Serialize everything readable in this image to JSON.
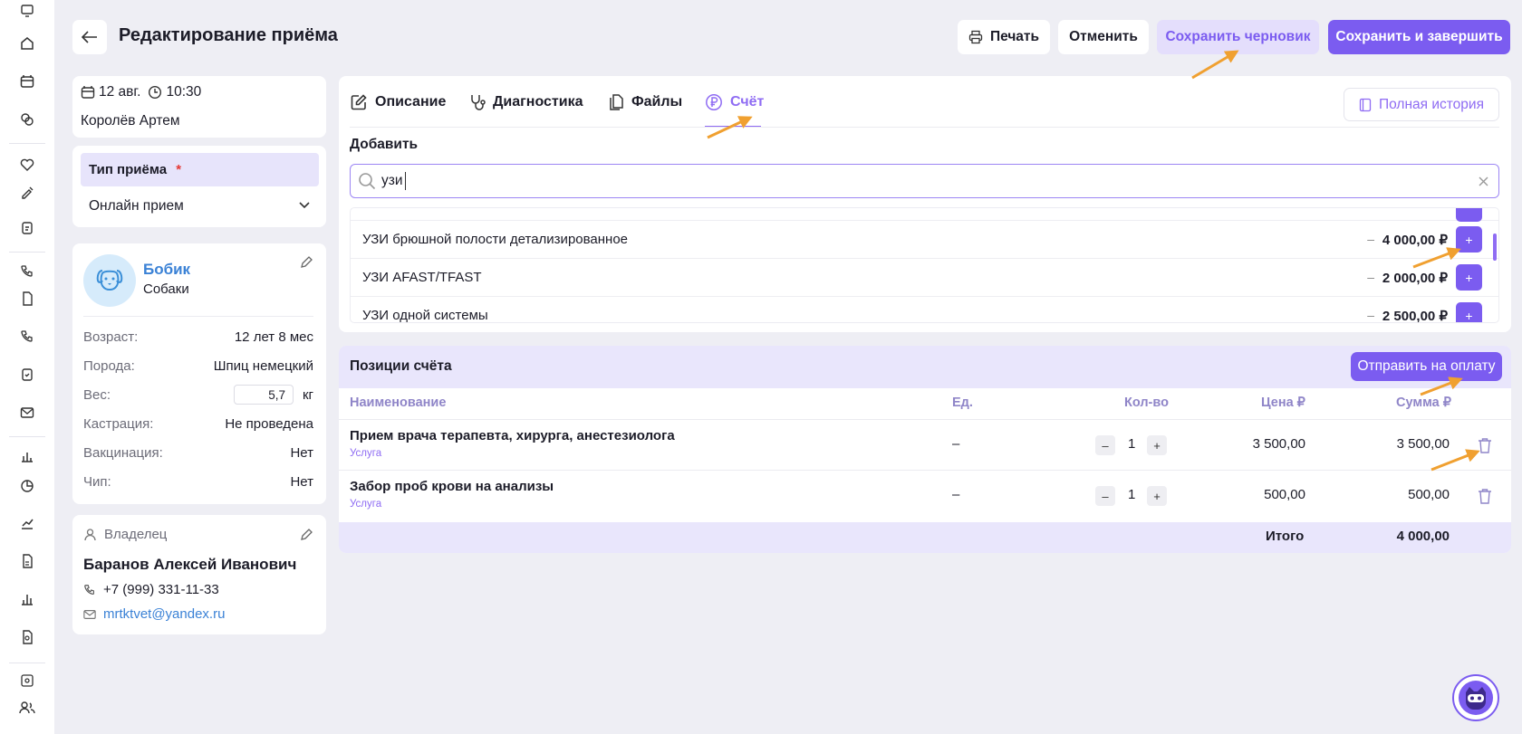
{
  "header": {
    "title": "Редактирование приёма",
    "print_label": "Печать",
    "cancel_label": "Отменить",
    "save_draft_label": "Сохранить черновик",
    "save_finish_label": "Сохранить и завершить"
  },
  "visit": {
    "date": "12 авг.",
    "time": "10:30",
    "doctor": "Королёв Артем"
  },
  "visit_type": {
    "label": "Тип приёма",
    "required_mark": "*",
    "value": "Онлайн прием"
  },
  "pet": {
    "name": "Бобик",
    "species": "Собаки",
    "rows": [
      {
        "label": "Возраст:",
        "value": "12 лет 8 мес"
      },
      {
        "label": "Порода:",
        "value": "Шпиц немецкий"
      },
      {
        "label": "Вес:",
        "value": "5,7",
        "unit": "кг"
      },
      {
        "label": "Кастрация:",
        "value": "Не проведена"
      },
      {
        "label": "Вакцинация:",
        "value": "Нет"
      },
      {
        "label": "Чип:",
        "value": "Нет"
      }
    ]
  },
  "owner": {
    "section_label": "Владелец",
    "name": "Баранов Алексей Иванович",
    "phone": "+7 (999) 331-11-33",
    "email": "mrtktvet@yandex.ru"
  },
  "tabs": [
    {
      "label": "Описание",
      "icon": "edit-icon"
    },
    {
      "label": "Диагностика",
      "icon": "stethoscope-icon"
    },
    {
      "label": "Файлы",
      "icon": "files-icon"
    },
    {
      "label": "Счёт",
      "icon": "ruble-icon",
      "active": true
    }
  ],
  "history_label": "Полная история",
  "add": {
    "label": "Добавить",
    "search_value": "узи",
    "results": [
      {
        "name": "УЗИ брюшной полости детализированное",
        "dash": "–",
        "price": "4 000,00 ₽",
        "add": "+"
      },
      {
        "name": "УЗИ AFAST/TFAST",
        "dash": "–",
        "price": "2 000,00 ₽",
        "add": "+"
      },
      {
        "name": "УЗИ одной системы",
        "dash": "–",
        "price": "2 500,00 ₽",
        "add": "+"
      }
    ]
  },
  "invoice": {
    "title": "Позиции счёта",
    "send_label": "Отправить на оплату",
    "columns": [
      "Наименование",
      "Ед.",
      "Кол-во",
      "Цена ₽",
      "Сумма ₽"
    ],
    "rows": [
      {
        "name": "Прием врача терапевта, хирурга, анестезиолога",
        "type": "Услуга",
        "unit": "–",
        "qty": "1",
        "price": "3 500,00",
        "sum": "3 500,00",
        "minus": "–",
        "plus": "+"
      },
      {
        "name": "Забор проб крови на анализы",
        "type": "Услуга",
        "unit": "–",
        "qty": "1",
        "price": "500,00",
        "sum": "500,00",
        "minus": "–",
        "plus": "+"
      }
    ],
    "total_label": "Итого",
    "total_value": "4 000,00"
  },
  "colors": {
    "accent": "#7b5cf0",
    "annotation_arrow": "#f0a030",
    "link": "#3b82d6"
  }
}
